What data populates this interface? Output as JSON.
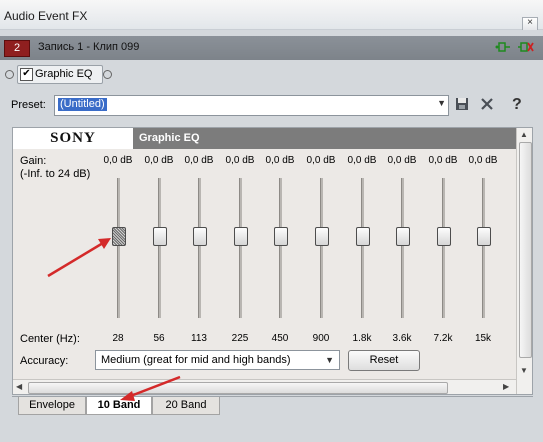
{
  "window": {
    "title": "Audio Event FX",
    "close_glyph": "×"
  },
  "chain": {
    "track_number": "2",
    "track_name": "Запись 1 - Клип 099",
    "plugin_chain_icon": "plugin-chain-icon",
    "remove_plugin_icon": "remove-plugin-icon"
  },
  "fx": {
    "name": "Graphic EQ",
    "enabled": true
  },
  "preset": {
    "label": "Preset:",
    "value": "(Untitled)",
    "save_icon": "save-icon",
    "delete_icon": "delete-icon",
    "help_glyph": "?"
  },
  "plugin": {
    "brand": "SONY",
    "title": "Graphic EQ",
    "gain_label": "Gain:\n(-Inf. to 24 dB)",
    "bands": [
      {
        "gain": "0,0 dB",
        "freq": "28"
      },
      {
        "gain": "0,0 dB",
        "freq": "56"
      },
      {
        "gain": "0,0 dB",
        "freq": "113"
      },
      {
        "gain": "0,0 dB",
        "freq": "225"
      },
      {
        "gain": "0,0 dB",
        "freq": "450"
      },
      {
        "gain": "0,0 dB",
        "freq": "900"
      },
      {
        "gain": "0,0 dB",
        "freq": "1.8k"
      },
      {
        "gain": "0,0 dB",
        "freq": "3.6k"
      },
      {
        "gain": "0,0 dB",
        "freq": "7.2k"
      },
      {
        "gain": "0,0 dB",
        "freq": "15k"
      }
    ],
    "center_label": "Center (Hz):",
    "accuracy_label": "Accuracy:",
    "accuracy_value": "Medium (great for mid and high bands)",
    "reset_label": "Reset"
  },
  "tabs": [
    {
      "label": "Envelope",
      "active": false
    },
    {
      "label": "10 Band",
      "active": true
    },
    {
      "label": "20 Band",
      "active": false
    }
  ],
  "colors": {
    "annotation_arrow": "#d42a2a",
    "selection": "#3a6cc8",
    "track_badge": "#8f1f1f"
  }
}
